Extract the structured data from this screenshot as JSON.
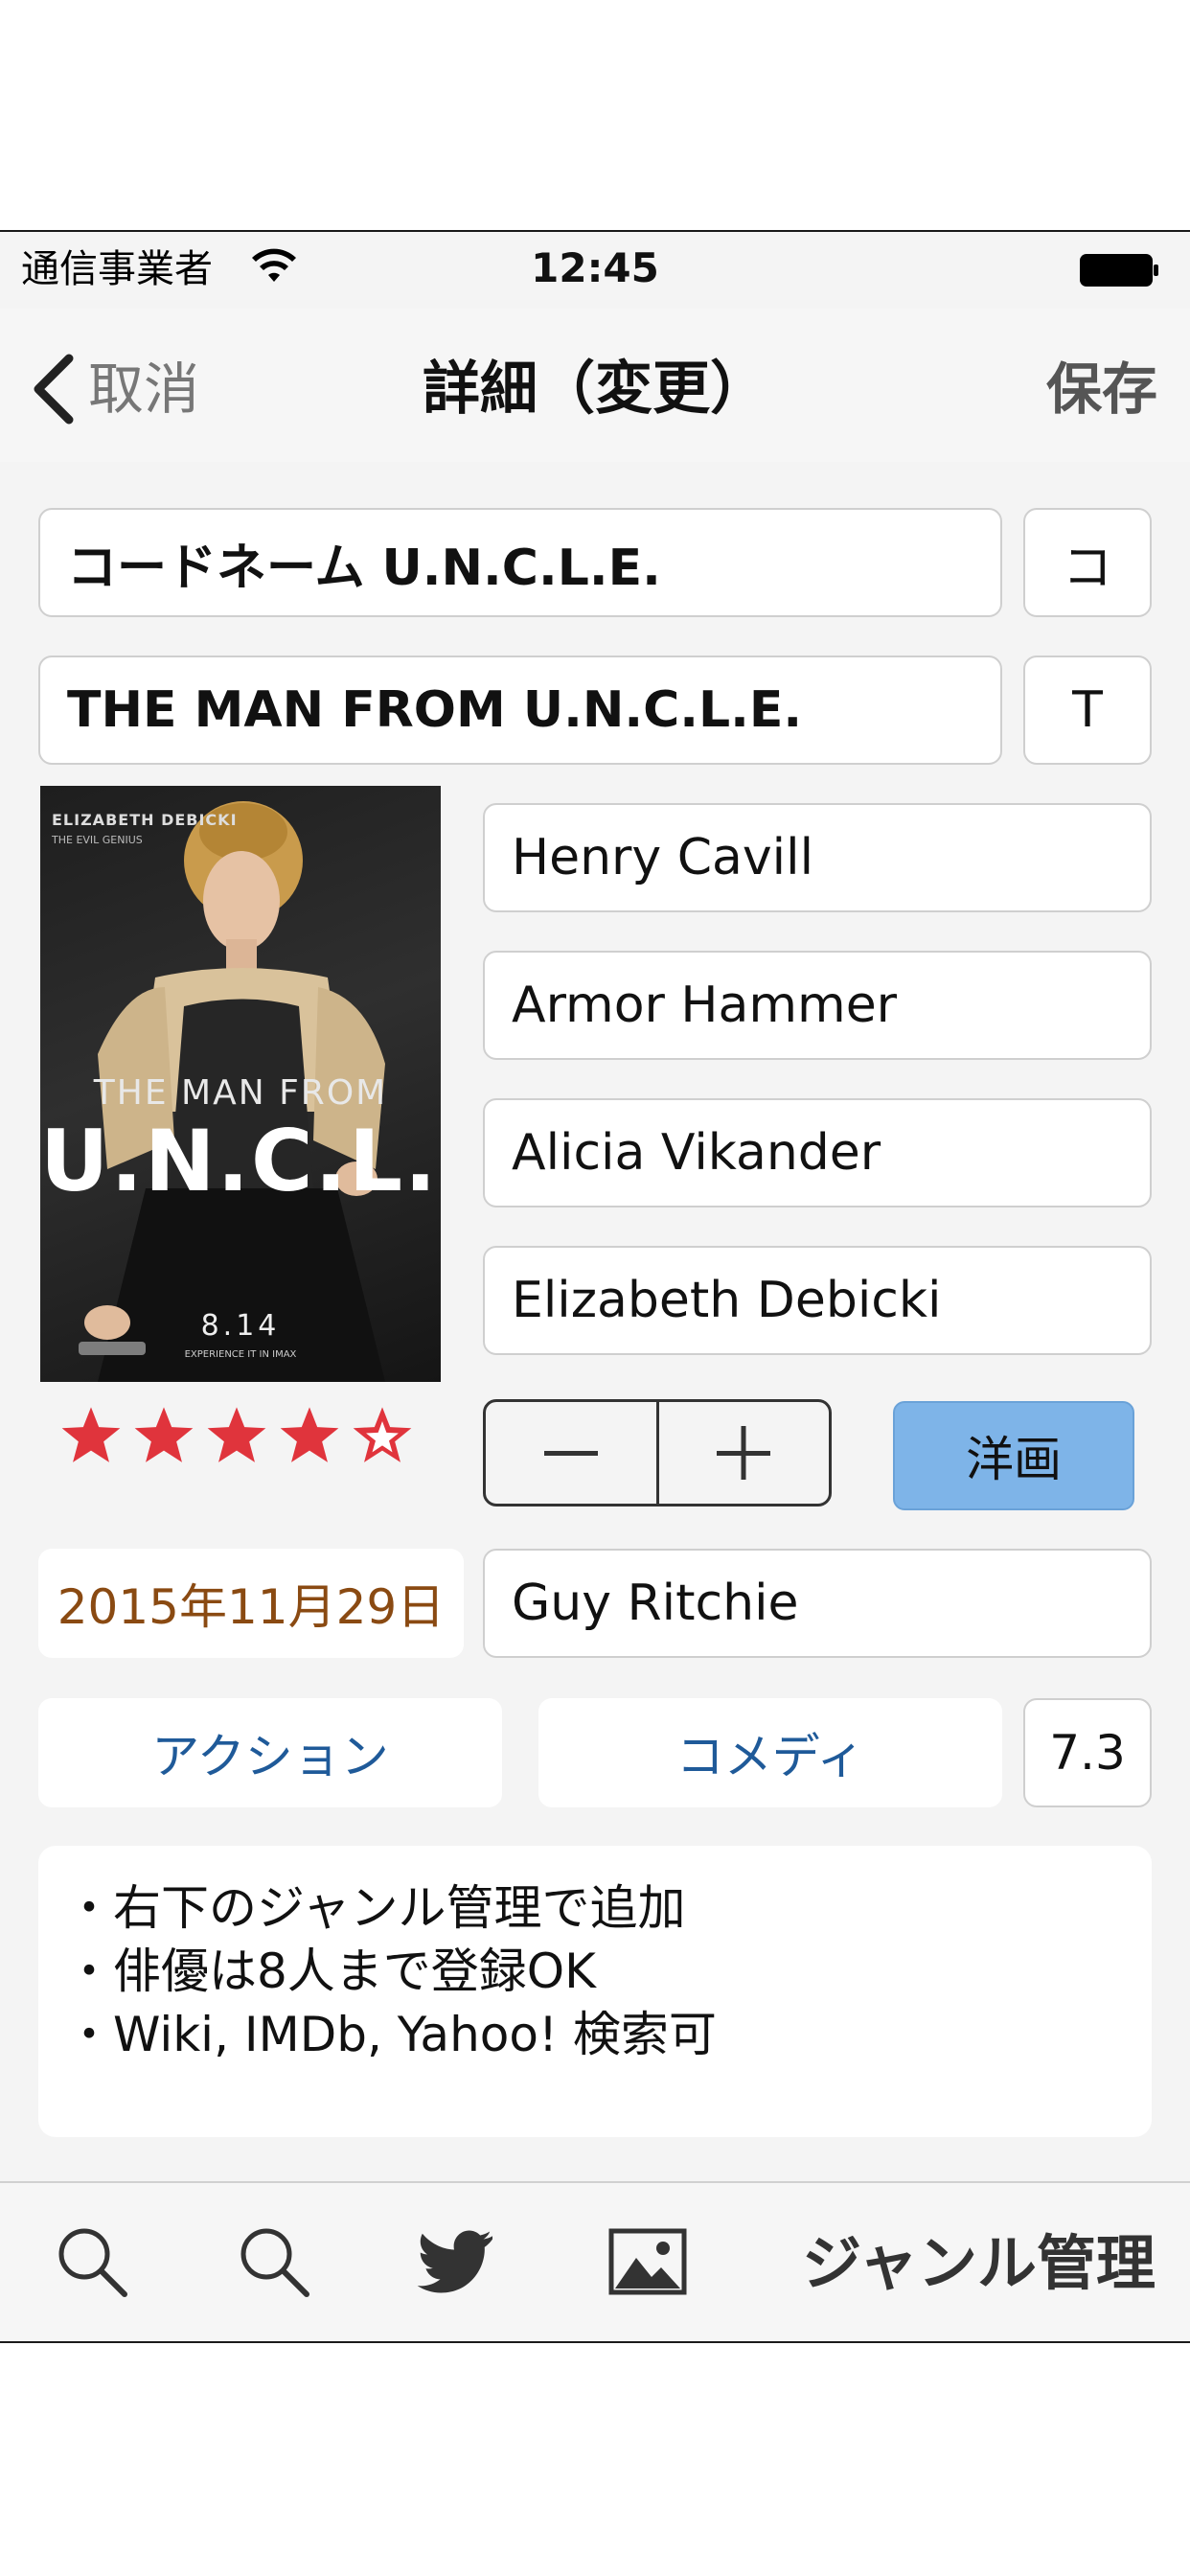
{
  "status": {
    "carrier": "通信事業者",
    "time": "12:45"
  },
  "nav": {
    "back_label": "取消",
    "title": "詳細（変更）",
    "save_label": "保存"
  },
  "title_jp": {
    "value": "コードネーム U.N.C.L.E.",
    "initial": "コ"
  },
  "title_en": {
    "value": "THE MAN FROM U.N.C.L.E.",
    "initial": "T"
  },
  "poster": {
    "actor": "ELIZABETH DEBICKI",
    "role": "THE EVIL GENIUS",
    "title_line1": "THE MAN FROM",
    "title_line2": "U.N.C.L.E.",
    "date": "8.14",
    "imax": "EXPERIENCE IT IN IMAX"
  },
  "cast": [
    "Henry Cavill",
    "Armor Hammer",
    "Alicia Vikander",
    "Elizabeth Debicki"
  ],
  "stars": {
    "filled": 4,
    "total": 5,
    "color": "#e0343c"
  },
  "category_button": "洋画",
  "watched_date": "2015年11月29日",
  "director": "Guy Ritchie",
  "genres": [
    "アクション",
    "コメディ"
  ],
  "score": "7.3",
  "notes": [
    "・右下のジャンル管理で追加",
    "・俳優は8人まで登録OK",
    "・Wiki, IMDb, Yahoo! 検索可"
  ],
  "toolbar": {
    "icons": [
      "search-icon",
      "search-icon",
      "twitter-icon",
      "image-icon"
    ],
    "genre_manage": "ジャンル管理"
  },
  "colors": {
    "accent_blue": "#7eb4e8",
    "date_text": "#8a4a12",
    "genre_text": "#1f5a99"
  }
}
